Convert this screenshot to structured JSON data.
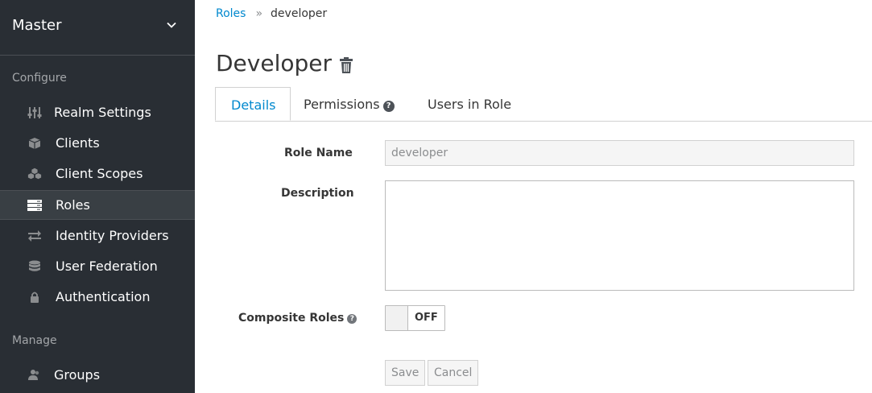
{
  "sidebar": {
    "realm": "Master",
    "configure_label": "Configure",
    "manage_label": "Manage",
    "configure_items": [
      {
        "label": "Realm Settings",
        "icon": "sliders-icon"
      },
      {
        "label": "Clients",
        "icon": "cube-icon"
      },
      {
        "label": "Client Scopes",
        "icon": "cubes-icon"
      },
      {
        "label": "Roles",
        "icon": "roles-icon",
        "active": true
      },
      {
        "label": "Identity Providers",
        "icon": "exchange-icon"
      },
      {
        "label": "User Federation",
        "icon": "database-icon"
      },
      {
        "label": "Authentication",
        "icon": "lock-icon"
      }
    ],
    "manage_items": [
      {
        "label": "Groups",
        "icon": "users-icon"
      }
    ]
  },
  "breadcrumb": {
    "parent": "Roles",
    "separator": "»",
    "current": "developer"
  },
  "page": {
    "title": "Developer"
  },
  "tabs": [
    {
      "label": "Details",
      "active": true
    },
    {
      "label": "Permissions",
      "has_help": true
    },
    {
      "label": "Users in Role"
    }
  ],
  "form": {
    "role_name_label": "Role Name",
    "role_name_value": "developer",
    "description_label": "Description",
    "description_value": "",
    "composite_label": "Composite Roles",
    "composite_state": "OFF"
  },
  "actions": {
    "save": "Save",
    "cancel": "Cancel"
  },
  "colors": {
    "sidebar_bg": "#292e34",
    "accent": "#0088ce",
    "active_item_bg": "#393f44"
  }
}
